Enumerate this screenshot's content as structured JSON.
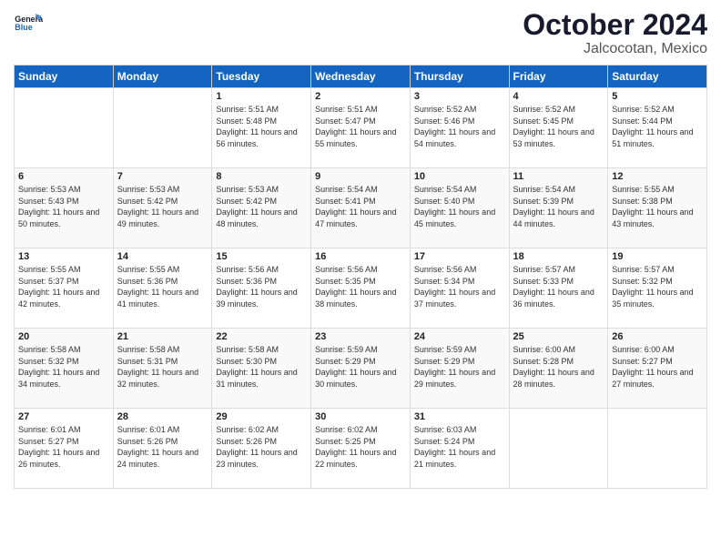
{
  "header": {
    "logo_general": "General",
    "logo_blue": "Blue",
    "title": "October 2024",
    "subtitle": "Jalcocotan, Mexico"
  },
  "days_of_week": [
    "Sunday",
    "Monday",
    "Tuesday",
    "Wednesday",
    "Thursday",
    "Friday",
    "Saturday"
  ],
  "weeks": [
    [
      {
        "day": "",
        "info": ""
      },
      {
        "day": "",
        "info": ""
      },
      {
        "day": "1",
        "info": "Sunrise: 5:51 AM\nSunset: 5:48 PM\nDaylight: 11 hours and 56 minutes."
      },
      {
        "day": "2",
        "info": "Sunrise: 5:51 AM\nSunset: 5:47 PM\nDaylight: 11 hours and 55 minutes."
      },
      {
        "day": "3",
        "info": "Sunrise: 5:52 AM\nSunset: 5:46 PM\nDaylight: 11 hours and 54 minutes."
      },
      {
        "day": "4",
        "info": "Sunrise: 5:52 AM\nSunset: 5:45 PM\nDaylight: 11 hours and 53 minutes."
      },
      {
        "day": "5",
        "info": "Sunrise: 5:52 AM\nSunset: 5:44 PM\nDaylight: 11 hours and 51 minutes."
      }
    ],
    [
      {
        "day": "6",
        "info": "Sunrise: 5:53 AM\nSunset: 5:43 PM\nDaylight: 11 hours and 50 minutes."
      },
      {
        "day": "7",
        "info": "Sunrise: 5:53 AM\nSunset: 5:42 PM\nDaylight: 11 hours and 49 minutes."
      },
      {
        "day": "8",
        "info": "Sunrise: 5:53 AM\nSunset: 5:42 PM\nDaylight: 11 hours and 48 minutes."
      },
      {
        "day": "9",
        "info": "Sunrise: 5:54 AM\nSunset: 5:41 PM\nDaylight: 11 hours and 47 minutes."
      },
      {
        "day": "10",
        "info": "Sunrise: 5:54 AM\nSunset: 5:40 PM\nDaylight: 11 hours and 45 minutes."
      },
      {
        "day": "11",
        "info": "Sunrise: 5:54 AM\nSunset: 5:39 PM\nDaylight: 11 hours and 44 minutes."
      },
      {
        "day": "12",
        "info": "Sunrise: 5:55 AM\nSunset: 5:38 PM\nDaylight: 11 hours and 43 minutes."
      }
    ],
    [
      {
        "day": "13",
        "info": "Sunrise: 5:55 AM\nSunset: 5:37 PM\nDaylight: 11 hours and 42 minutes."
      },
      {
        "day": "14",
        "info": "Sunrise: 5:55 AM\nSunset: 5:36 PM\nDaylight: 11 hours and 41 minutes."
      },
      {
        "day": "15",
        "info": "Sunrise: 5:56 AM\nSunset: 5:36 PM\nDaylight: 11 hours and 39 minutes."
      },
      {
        "day": "16",
        "info": "Sunrise: 5:56 AM\nSunset: 5:35 PM\nDaylight: 11 hours and 38 minutes."
      },
      {
        "day": "17",
        "info": "Sunrise: 5:56 AM\nSunset: 5:34 PM\nDaylight: 11 hours and 37 minutes."
      },
      {
        "day": "18",
        "info": "Sunrise: 5:57 AM\nSunset: 5:33 PM\nDaylight: 11 hours and 36 minutes."
      },
      {
        "day": "19",
        "info": "Sunrise: 5:57 AM\nSunset: 5:32 PM\nDaylight: 11 hours and 35 minutes."
      }
    ],
    [
      {
        "day": "20",
        "info": "Sunrise: 5:58 AM\nSunset: 5:32 PM\nDaylight: 11 hours and 34 minutes."
      },
      {
        "day": "21",
        "info": "Sunrise: 5:58 AM\nSunset: 5:31 PM\nDaylight: 11 hours and 32 minutes."
      },
      {
        "day": "22",
        "info": "Sunrise: 5:58 AM\nSunset: 5:30 PM\nDaylight: 11 hours and 31 minutes."
      },
      {
        "day": "23",
        "info": "Sunrise: 5:59 AM\nSunset: 5:29 PM\nDaylight: 11 hours and 30 minutes."
      },
      {
        "day": "24",
        "info": "Sunrise: 5:59 AM\nSunset: 5:29 PM\nDaylight: 11 hours and 29 minutes."
      },
      {
        "day": "25",
        "info": "Sunrise: 6:00 AM\nSunset: 5:28 PM\nDaylight: 11 hours and 28 minutes."
      },
      {
        "day": "26",
        "info": "Sunrise: 6:00 AM\nSunset: 5:27 PM\nDaylight: 11 hours and 27 minutes."
      }
    ],
    [
      {
        "day": "27",
        "info": "Sunrise: 6:01 AM\nSunset: 5:27 PM\nDaylight: 11 hours and 26 minutes."
      },
      {
        "day": "28",
        "info": "Sunrise: 6:01 AM\nSunset: 5:26 PM\nDaylight: 11 hours and 24 minutes."
      },
      {
        "day": "29",
        "info": "Sunrise: 6:02 AM\nSunset: 5:26 PM\nDaylight: 11 hours and 23 minutes."
      },
      {
        "day": "30",
        "info": "Sunrise: 6:02 AM\nSunset: 5:25 PM\nDaylight: 11 hours and 22 minutes."
      },
      {
        "day": "31",
        "info": "Sunrise: 6:03 AM\nSunset: 5:24 PM\nDaylight: 11 hours and 21 minutes."
      },
      {
        "day": "",
        "info": ""
      },
      {
        "day": "",
        "info": ""
      }
    ]
  ]
}
